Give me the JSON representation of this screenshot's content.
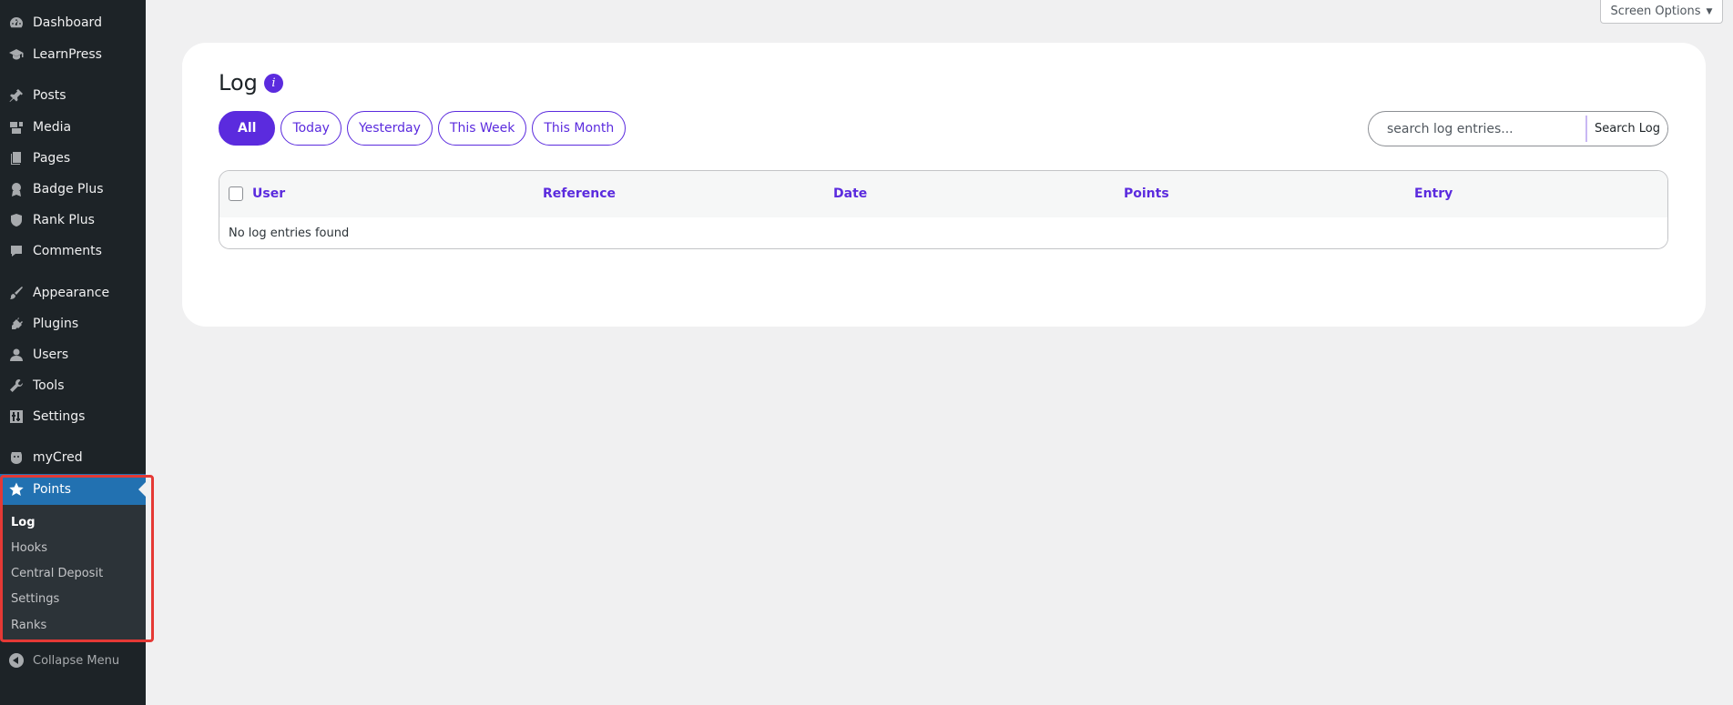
{
  "sidebar": {
    "items": [
      {
        "label": "Dashboard",
        "icon": "dashboard-icon"
      },
      {
        "label": "LearnPress",
        "icon": "graduation-cap-icon"
      },
      {
        "label": "Posts",
        "icon": "pin-icon"
      },
      {
        "label": "Media",
        "icon": "media-icon"
      },
      {
        "label": "Pages",
        "icon": "pages-icon"
      },
      {
        "label": "Badge Plus",
        "icon": "badge-icon"
      },
      {
        "label": "Rank Plus",
        "icon": "shield-icon"
      },
      {
        "label": "Comments",
        "icon": "comment-icon"
      },
      {
        "label": "Appearance",
        "icon": "brush-icon"
      },
      {
        "label": "Plugins",
        "icon": "plugin-icon"
      },
      {
        "label": "Users",
        "icon": "user-icon"
      },
      {
        "label": "Tools",
        "icon": "wrench-icon"
      },
      {
        "label": "Settings",
        "icon": "settings-icon"
      },
      {
        "label": "myCred",
        "icon": "mycred-icon"
      },
      {
        "label": "Points",
        "icon": "star-icon"
      }
    ],
    "submenu": [
      "Log",
      "Hooks",
      "Central Deposit",
      "Settings",
      "Ranks"
    ],
    "collapse_label": "Collapse Menu"
  },
  "screen_options": {
    "label": "Screen Options",
    "arrow": "▼"
  },
  "page": {
    "title": "Log",
    "info_glyph": "i"
  },
  "filters": [
    "All",
    "Today",
    "Yesterday",
    "This Week",
    "This Month"
  ],
  "search": {
    "placeholder": "search log entries...",
    "button_label": "Search Log"
  },
  "table": {
    "columns": [
      "User",
      "Reference",
      "Date",
      "Points",
      "Entry"
    ],
    "empty_message": "No log entries found"
  },
  "colors": {
    "accent": "#5b2bde",
    "sidebar_bg": "#1d2327",
    "active_menu": "#2271b1",
    "highlight": "#e53935"
  }
}
